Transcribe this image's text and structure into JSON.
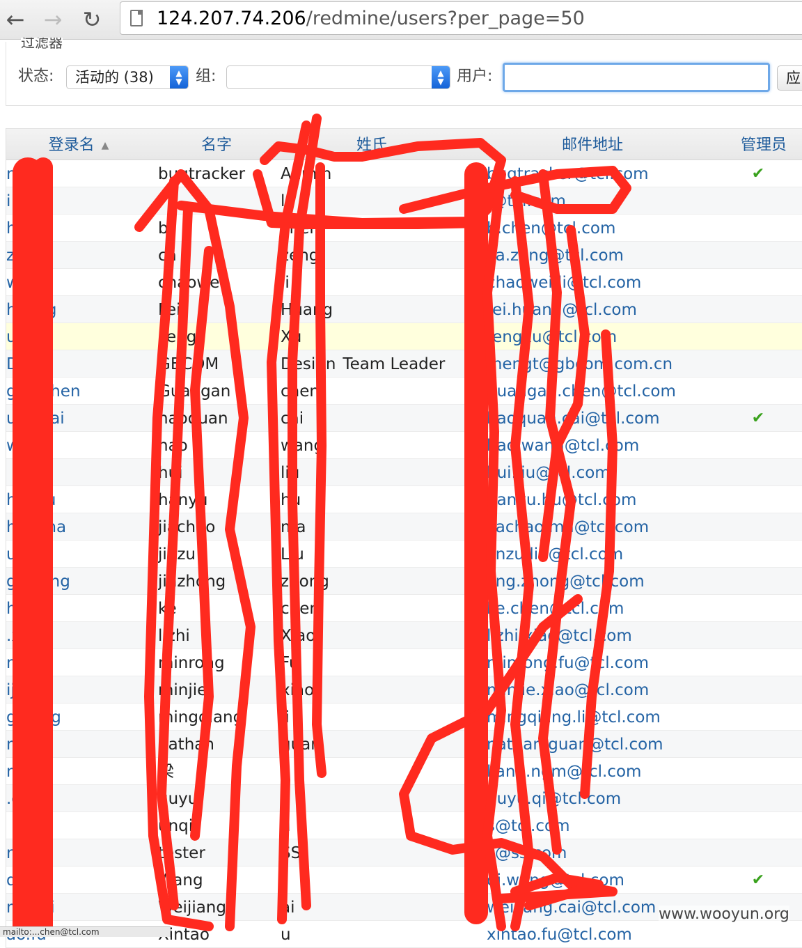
{
  "browser": {
    "url_host": "124.207.74.206",
    "url_path": "/redmine/users?per_page=50",
    "back_icon": "arrow-left",
    "forward_icon": "arrow-right",
    "reload_icon": "reload"
  },
  "filters": {
    "legend": "过滤器",
    "status_label": "状态:",
    "status_value": "活动的 (38)",
    "group_label": "组:",
    "group_value": "",
    "user_label": "用户:",
    "user_value": "",
    "apply_label": "应"
  },
  "table": {
    "headers": {
      "login": "登录名",
      "firstname": "名字",
      "lastname": "姓氏",
      "mail": "邮件地址",
      "admin": "管理员"
    },
    "sort_icon": "▲",
    "rows": [
      {
        "login": "n",
        "first": "bugtracker",
        "last": "Admin",
        "mail": "bugtracker@tcl.com",
        "admin": "✔",
        "highlight": false
      },
      {
        "login": "i",
        "first": "l",
        "last": "l",
        "mail": "i@tcl.com",
        "admin": "",
        "highlight": false
      },
      {
        "login": "hen",
        "first": "b",
        "last": "chen",
        "mail": "b.chen@tcl.com",
        "admin": "",
        "highlight": false
      },
      {
        "login": "zeng",
        "first": "ca",
        "last": "zeng",
        "mail": "ca.zeng@tcl.com",
        "admin": "",
        "highlight": false
      },
      {
        "login": "wei.li",
        "first": "chaowei",
        "last": "li",
        "mail": "chaowei.li@tcl.com",
        "admin": "",
        "highlight": false
      },
      {
        "login": "huang",
        "first": "Fei",
        "last": "Huang",
        "mail": "fei.huang@tcl.com",
        "admin": "",
        "highlight": false
      },
      {
        "login": "u",
        "first": "Feng",
        "last": "Xu",
        "mail": "fengxu@tcl.com",
        "admin": "",
        "highlight": true
      },
      {
        "login": "DM",
        "first": "GBCOM",
        "last": "Design",
        "extra": "Team Leader",
        "mail": "mengt@gbcom.com.cn",
        "admin": "",
        "highlight": false
      },
      {
        "login": "gan.chen",
        "first": "Guangan",
        "last": "chen",
        "mail": "guangan.chen@tcl.com",
        "admin": "",
        "highlight": false
      },
      {
        "login": "uan.cai",
        "first": "haoquan",
        "last": "cai",
        "mail": "haoquan.cai@tcl.com",
        "admin": "✔",
        "highlight": false
      },
      {
        "login": "wang",
        "first": "hao",
        "last": "wang",
        "mail": "hao.wang@tcl.com",
        "admin": "",
        "highlight": false
      },
      {
        "login": "",
        "first": "hui",
        "last": "liu",
        "mail": "hui.liu@tcl.com",
        "admin": "",
        "highlight": false
      },
      {
        "login": "hanyu",
        "first": "hanyu",
        "last": "hu",
        "mail": "hanyu.hu@tcl.com",
        "admin": "",
        "highlight": false
      },
      {
        "login": "hao.ma",
        "first": "jiachao",
        "last": "ma",
        "mail": "jiachao.ma@tcl.com",
        "admin": "",
        "highlight": false
      },
      {
        "login": "u.liu",
        "first": "jinzu",
        "last": "Liu",
        "mail": "jinzu.liu@tcl.com",
        "admin": "",
        "highlight": false
      },
      {
        "login": "g.zhong",
        "first": "jinzhong",
        "last": "zhong",
        "mail": "jing.zhong@tcl.com",
        "admin": "",
        "highlight": false
      },
      {
        "login": "hen",
        "first": "ke",
        "last": "chen",
        "mail": "ke.chen@tcl.com",
        "admin": "",
        "highlight": false
      },
      {
        "login": ".xiao",
        "first": "lizhi",
        "last": "Xiao",
        "mail": "lizhi.xiao@tcl.com",
        "admin": "",
        "highlight": false
      },
      {
        "login": "ng.fu",
        "first": "minrong",
        "last": "Fu",
        "mail": "minrong.fu@tcl.com",
        "admin": "",
        "highlight": false
      },
      {
        "login": "ijie",
        "first": "minjie",
        "last": "xiao",
        "mail": "minjie.xiao@tcl.com",
        "admin": "",
        "highlight": false
      },
      {
        "login": "gqiang",
        "first": "mingqiang",
        "last": "li",
        "mail": "mingqiang.li@tcl.com",
        "admin": "",
        "highlight": false
      },
      {
        "login": "n",
        "first": "nathan",
        "last": "guan",
        "mail": "nathan.guan@tcl.com",
        "admin": "",
        "highlight": false
      },
      {
        "login": "ngm",
        "first": "梁",
        "last": "",
        "mail": "liang.ngm@tcl.com",
        "admin": "",
        "highlight": false
      },
      {
        "login": ".qi",
        "first": "quyu",
        "last": "",
        "mail": "quyu.qi@tcl.com",
        "admin": "",
        "highlight": false
      },
      {
        "login": "",
        "first": "unqi",
        "last": "u",
        "mail": "s@tcl.com",
        "admin": "",
        "highlight": false
      },
      {
        "login": "r",
        "first": "tester",
        "last": "SS",
        "mail": "s@ss.com",
        "admin": "",
        "highlight": false
      },
      {
        "login": "qi",
        "first": "Wang",
        "last": "",
        "mail": "qi.wang@tcl.com",
        "admin": "✔",
        "highlight": false
      },
      {
        "login": "ng.cai",
        "first": "Weijiang",
        "last": "ai",
        "mail": "weijiang.cai@tcl.com",
        "admin": "",
        "highlight": false
      },
      {
        "login": "ao.fu",
        "first": "Xintao",
        "last": "u",
        "mail": "xintao.fu@tcl.com",
        "admin": "",
        "highlight": false
      }
    ]
  },
  "watermark": "www.wooyun.org",
  "status_bar": "mailto:...chen@tcl.com",
  "colors": {
    "link": "#2463a4",
    "scribble": "#ff2a1f",
    "check": "#3aa21e"
  }
}
